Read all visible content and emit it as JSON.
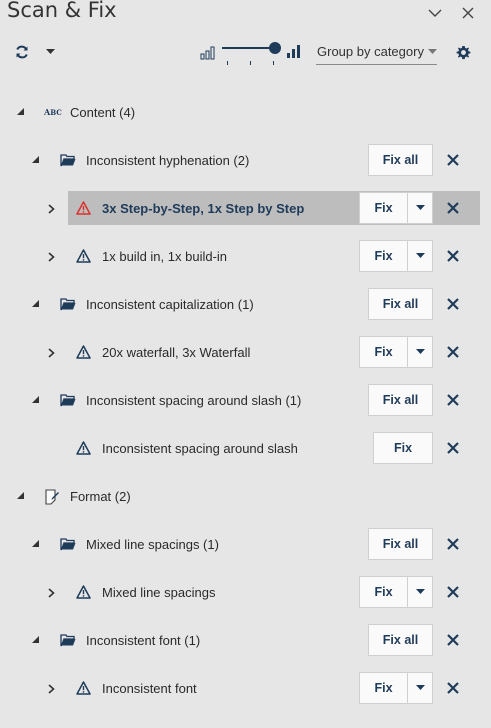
{
  "window": {
    "title": "Scan & Fix"
  },
  "toolbar": {
    "group_by": "Group by category"
  },
  "tree": {
    "content": {
      "label": "Content (4)",
      "hyphenation": {
        "label": "Inconsistent hyphenation (2)",
        "fix_all": "Fix all",
        "items": [
          {
            "label": "3x Step-by-Step, 1x Step by Step",
            "fix": "Fix",
            "severity": "error"
          },
          {
            "label": "1x build in, 1x build-in",
            "fix": "Fix",
            "severity": "warning"
          }
        ]
      },
      "capitalization": {
        "label": "Inconsistent capitalization (1)",
        "fix_all": "Fix all",
        "items": [
          {
            "label": "20x waterfall, 3x Waterfall",
            "fix": "Fix"
          }
        ]
      },
      "slash": {
        "label": "Inconsistent spacing around slash (1)",
        "fix_all": "Fix all",
        "items": [
          {
            "label": "Inconsistent spacing around slash",
            "fix": "Fix"
          }
        ]
      }
    },
    "format": {
      "label": "Format (2)",
      "line_spacings": {
        "label": "Mixed line spacings (1)",
        "fix_all": "Fix all",
        "items": [
          {
            "label": "Mixed line spacings",
            "fix": "Fix"
          }
        ]
      },
      "font": {
        "label": "Inconsistent font (1)",
        "fix_all": "Fix all",
        "items": [
          {
            "label": "Inconsistent font",
            "fix": "Fix"
          }
        ]
      }
    }
  },
  "colors": {
    "accent": "#1f3b5a",
    "error": "#d9302c",
    "selected": "#bdbdbd",
    "background": "#e6e6e6"
  }
}
